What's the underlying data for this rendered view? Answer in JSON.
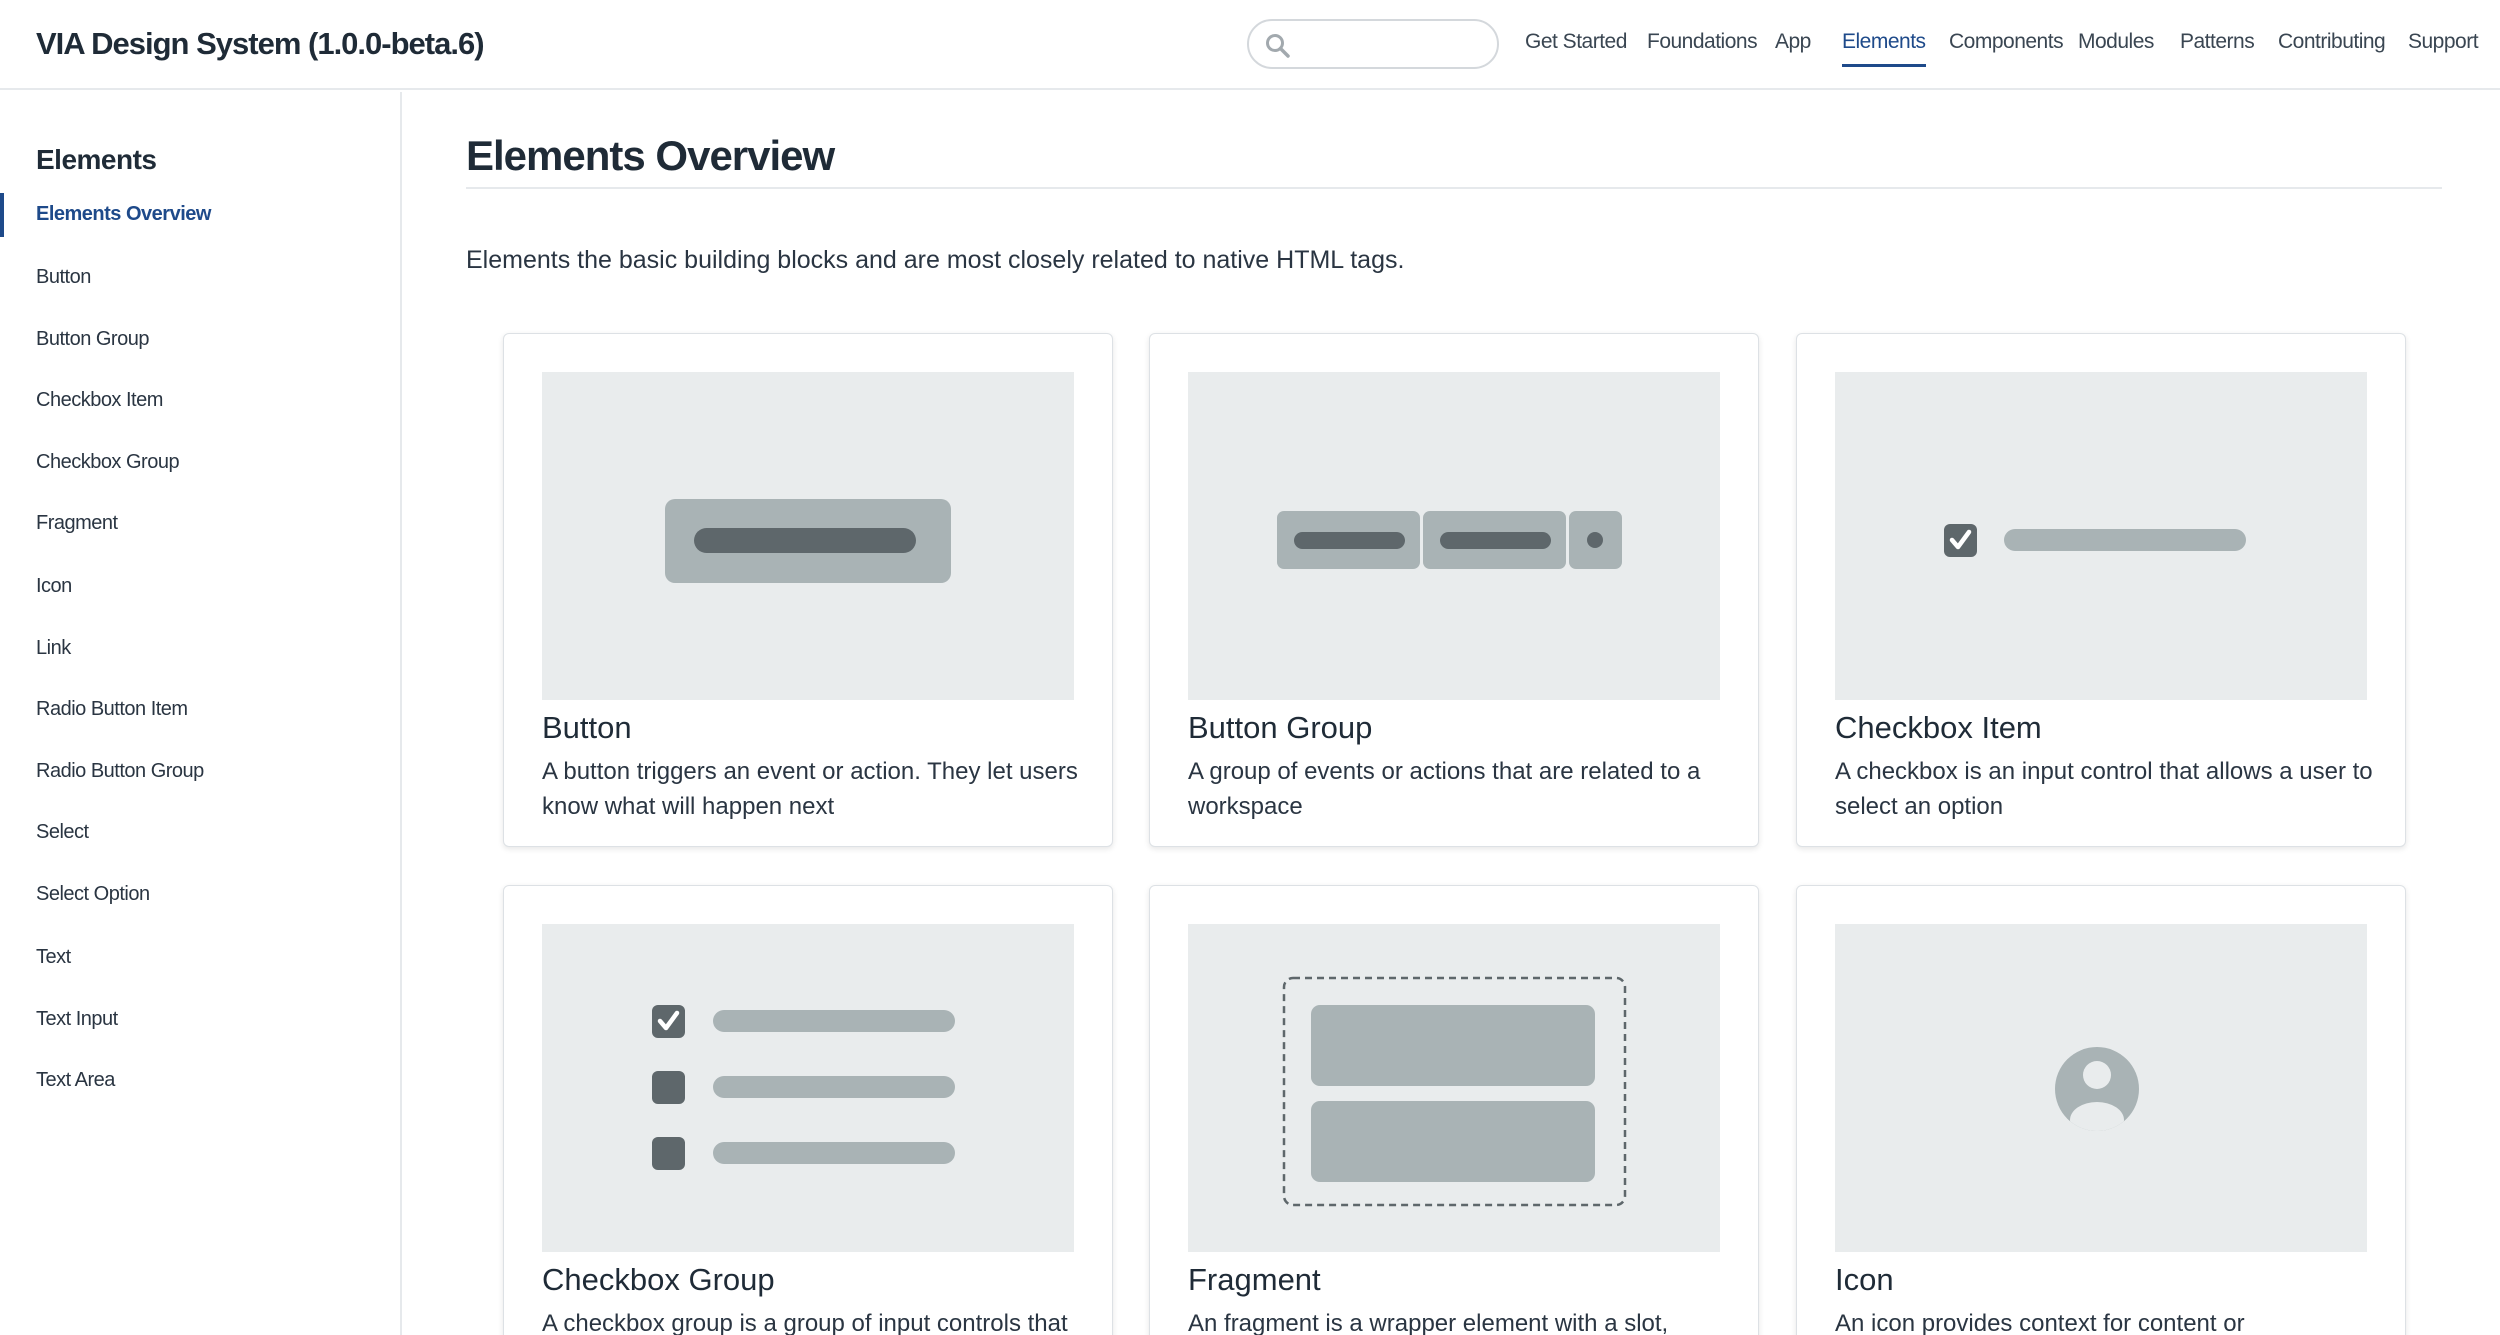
{
  "header": {
    "brand": "VIA Design System (1.0.0-beta.6)",
    "search": {
      "placeholder": "",
      "icon": "search-icon"
    },
    "nav": [
      {
        "label": "Get Started",
        "active": false
      },
      {
        "label": "Foundations",
        "active": false
      },
      {
        "label": "App",
        "active": false
      },
      {
        "label": "Elements",
        "active": true
      },
      {
        "label": "Components",
        "active": false
      },
      {
        "label": "Modules",
        "active": false
      },
      {
        "label": "Patterns",
        "active": false
      },
      {
        "label": "Contributing",
        "active": false
      },
      {
        "label": "Support",
        "active": false
      }
    ]
  },
  "sidebar": {
    "title": "Elements",
    "items": [
      {
        "label": "Elements Overview",
        "active": true
      },
      {
        "label": "Button",
        "active": false
      },
      {
        "label": "Button Group",
        "active": false
      },
      {
        "label": "Checkbox Item",
        "active": false
      },
      {
        "label": "Checkbox Group",
        "active": false
      },
      {
        "label": "Fragment",
        "active": false
      },
      {
        "label": "Icon",
        "active": false
      },
      {
        "label": "Link",
        "active": false
      },
      {
        "label": "Radio Button Item",
        "active": false
      },
      {
        "label": "Radio Button Group",
        "active": false
      },
      {
        "label": "Select",
        "active": false
      },
      {
        "label": "Select Option",
        "active": false
      },
      {
        "label": "Text",
        "active": false
      },
      {
        "label": "Text Input",
        "active": false
      },
      {
        "label": "Text Area",
        "active": false
      }
    ]
  },
  "main": {
    "title": "Elements Overview",
    "intro": "Elements the basic building blocks and are most closely related to native HTML tags.",
    "cards": [
      {
        "title": "Button",
        "desc": "A button triggers an event or action. They let users know what will happen next",
        "illustration": "button-illustration"
      },
      {
        "title": "Button Group",
        "desc": "A group of events or actions that are related to a workspace",
        "illustration": "button-group-illustration"
      },
      {
        "title": "Checkbox Item",
        "desc": "A checkbox is an input control that allows a user to select an option",
        "illustration": "checkbox-item-illustration"
      },
      {
        "title": "Checkbox Group",
        "desc": "A checkbox group is a group of input controls that",
        "illustration": "checkbox-group-illustration"
      },
      {
        "title": "Fragment",
        "desc": "An fragment is a wrapper element with a slot,",
        "illustration": "fragment-illustration"
      },
      {
        "title": "Icon",
        "desc": "An icon provides context for content or",
        "illustration": "user-icon-illustration"
      }
    ]
  },
  "colors": {
    "accent": "#1e4a8a",
    "text": "#1f2b37",
    "placeholder_bg": "#e9eced",
    "placeholder_dark": "#5e676b",
    "placeholder_mid": "#a9b3b5"
  }
}
